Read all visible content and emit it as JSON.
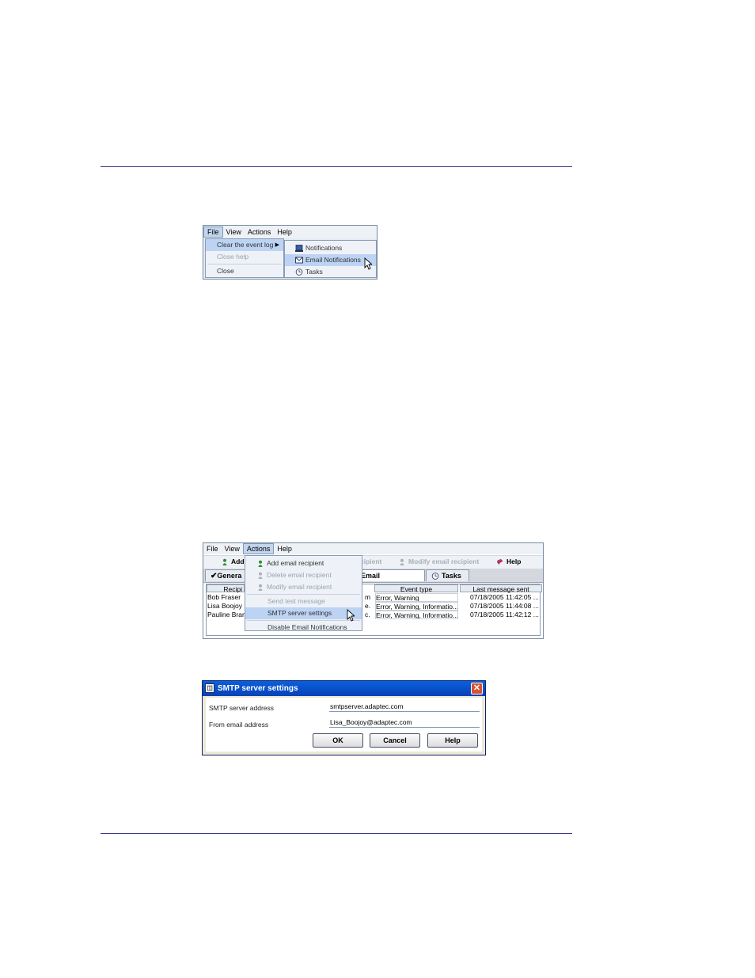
{
  "colors": {
    "rule": "#3c3c8c",
    "menu_highlight": "#bcd3f3",
    "titlebar": "#0a5fdc"
  },
  "shot1": {
    "menubar": [
      "File",
      "View",
      "Actions",
      "Help"
    ],
    "file_menu": [
      "Clear the event log",
      "Close help",
      "Close"
    ],
    "submenu": [
      {
        "label": "Notifications",
        "icon": "monitor-icon"
      },
      {
        "label": "Email Notifications",
        "icon": "envelope-icon"
      },
      {
        "label": "Tasks",
        "icon": "clock-icon"
      }
    ]
  },
  "shot2": {
    "menubar": [
      "File",
      "View",
      "Actions",
      "Help"
    ],
    "toolbar": {
      "add": "Add",
      "delete_partial": "cipient",
      "modify": "Modify email recipient",
      "help": "Help"
    },
    "tabs": {
      "general": "Genera",
      "email": "Email Notifications",
      "tasks": "Tasks"
    },
    "actions_menu": [
      "Add email recipient",
      "Delete email recipient",
      "Modify email recipient",
      "Send test message",
      "SMTP server settings",
      "Disable Email Notifications"
    ],
    "columns": {
      "recipient": "Recipi",
      "event_type": "Event type",
      "last_sent": "Last message sent"
    },
    "rows": [
      {
        "name": "Bob Fraser",
        "mid": "m",
        "events": "Error, Warning",
        "last": "07/18/2005 11:42:05 ..."
      },
      {
        "name": "Lisa Boojoy",
        "mid": "e.",
        "events": "Error, Warning, Informatio...",
        "last": "07/18/2005 11:44:08 ..."
      },
      {
        "name": "Pauline Bran",
        "mid": "c.",
        "events": "Error, Warning, Informatio...",
        "last": "07/18/2005 11:42:12 ..."
      }
    ]
  },
  "shot3": {
    "title": "SMTP server settings",
    "smtp_label": "SMTP server address",
    "smtp_value": "smtpserver.adaptec.com",
    "from_label": "From email address",
    "from_value": "Lisa_Boojoy@adaptec.com",
    "ok": "OK",
    "cancel": "Cancel",
    "help": "Help"
  }
}
